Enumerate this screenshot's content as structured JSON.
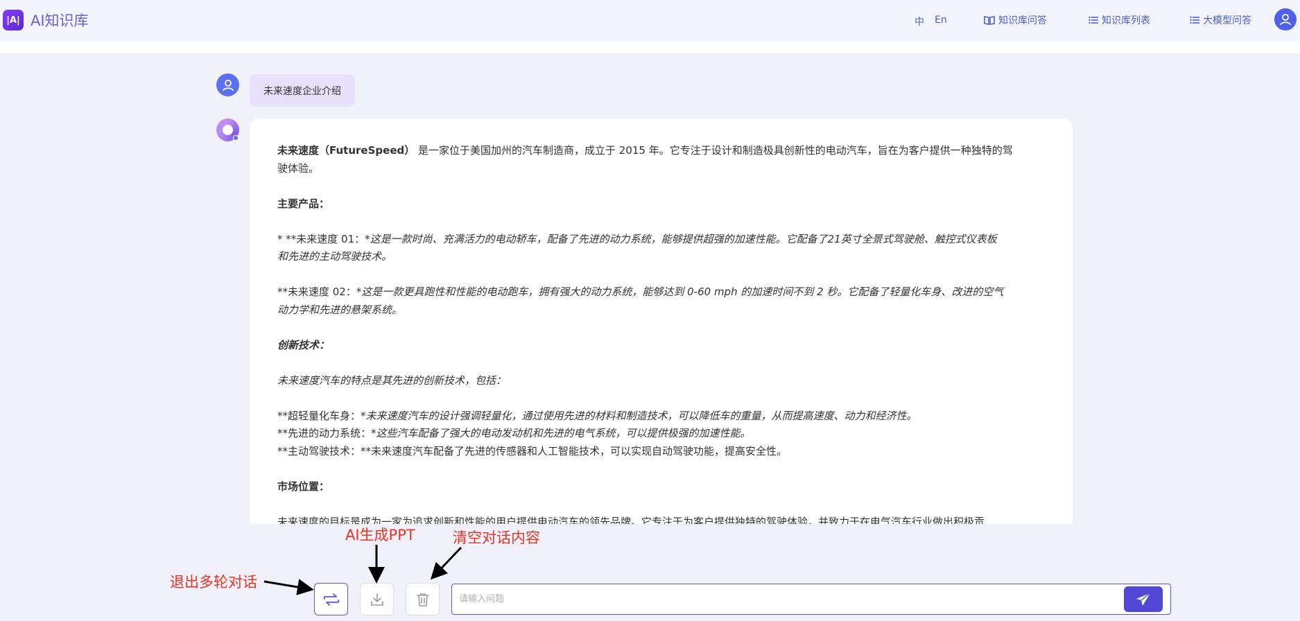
{
  "header": {
    "app_title": "AI知识库",
    "logo_mark": "|A|",
    "lang_zh": "中",
    "lang_en": "En",
    "nav": [
      {
        "label": "知识库问答",
        "icon": "book-icon"
      },
      {
        "label": "知识库列表",
        "icon": "list-icon"
      },
      {
        "label": "大模型问答",
        "icon": "list-icon"
      }
    ]
  },
  "chat": {
    "user_message": "未来速度企业介绍",
    "answer": {
      "intro_bold": "未来速度（FutureSpeed）",
      "intro_rest_line1": " 是一家位于美国加州的汽车制造商，成立于 2015 年。它专注于设计和制造极具创新性的电动汽车，旨在为客户提供一种独特的驾",
      "intro_rest_line2": "驶体验。",
      "products_heading": "主要产品：",
      "product1_prefix": "* **未来速度 01：*",
      "product1_line1": "这是一款时尚、充满活力的电动轿车，配备了先进的动力系统，能够提供超强的加速性能。它配备了21英寸全景式驾驶舱、触控式仪表板",
      "product1_line2": "和先进的主动驾驶技术。",
      "product2_prefix": "**未来速度 02：*",
      "product2_line1": "这是一款更具跑性和性能的电动跑车，拥有强大的动力系统，能够达到 0-60 mph 的加速时间不到 2 秒。它配备了轻量化车身、改进的空气",
      "product2_line2": "动力学和先进的悬架系统。",
      "tech_heading": "创新技术：",
      "tech_intro": "未来速度汽车的特点是其先进的创新技术，包括：",
      "tech1_prefix": "**超轻量化车身：*",
      "tech1_text": "未来速度汽车的设计强调轻量化，通过使用先进的材料和制造技术，可以降低车的重量，从而提高速度、动力和经济性。",
      "tech2_prefix": "**先进的动力系统：*",
      "tech2_text": "这些汽车配备了强大的电动发动机和先进的电气系统，可以提供极强的加速性能。",
      "tech3_text": "**主动驾驶技术：**未来速度汽车配备了先进的传感器和人工智能技术，可以实现自动驾驶功能，提高安全性。",
      "market_heading": "市场位置：",
      "market_text": "未来速度的目标是成为一家为追求创新和性能的用户提供电动汽车的领先品牌。它专注于为客户提供独特的驾驶体验，并致力于在电气汽车行业做出积极贡"
    }
  },
  "input": {
    "placeholder": "请输入问题",
    "value": ""
  },
  "annotations": {
    "exit_multiturn": "退出多轮对话",
    "ai_ppt": "AI生成PPT",
    "clear_chat": "清空对话内容"
  },
  "colors": {
    "accent": "#5148d8",
    "nav_text": "#4a5fd6",
    "annotation": "#f0321e",
    "user_bubble": "#e7e1fb"
  }
}
